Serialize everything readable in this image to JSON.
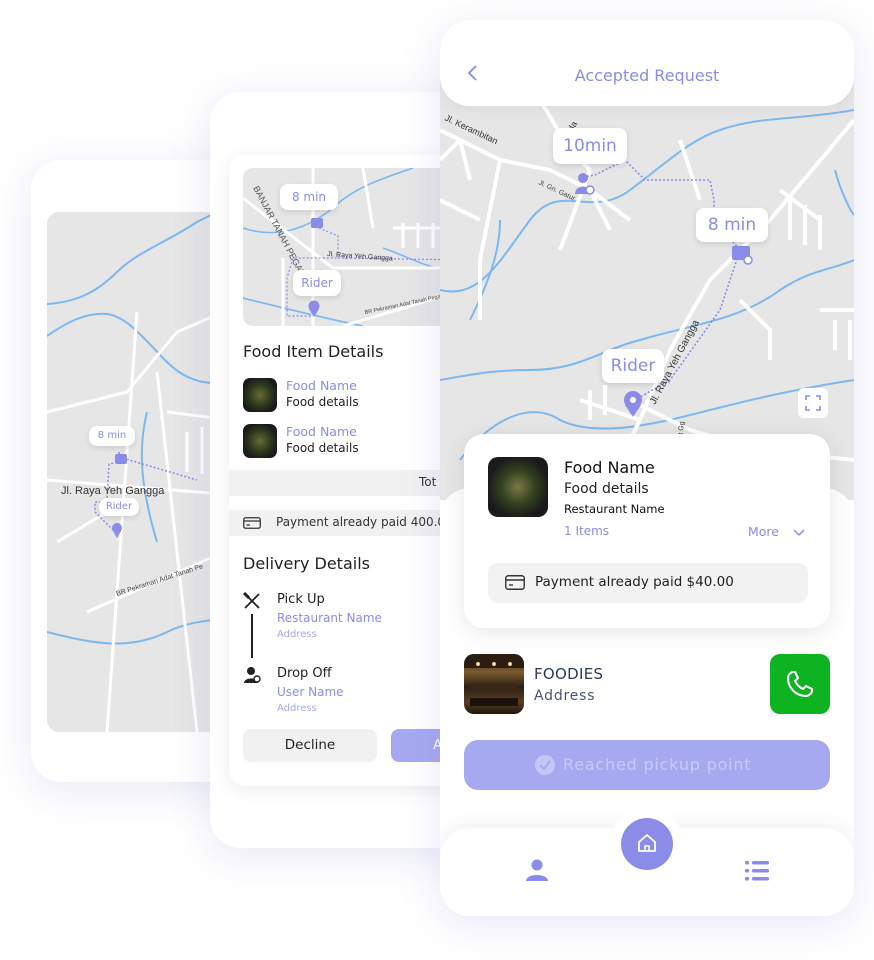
{
  "phone1": {
    "map": {
      "eta": "8 min",
      "rider": "Rider",
      "road_main": "Jl. Raya Yeh Gangga",
      "road_side": "BR Pekraman Adat Tanah Pe"
    }
  },
  "phone2": {
    "map": {
      "eta": "8 min",
      "rider": "Rider",
      "area": "BANJAR TANAH PEGAT",
      "road_main": "Jl. Raya Yeh Gangga",
      "road_side": "BR Pekraman Adat Tanah Pegat"
    },
    "food_heading": "Food Item Details",
    "foods": [
      {
        "name": "Food Name",
        "details": "Food details"
      },
      {
        "name": "Food Name",
        "details": "Food details"
      }
    ],
    "total_label": "Tot",
    "payment": "Payment already paid 400.0",
    "delivery_heading": "Delivery Details",
    "pickup": {
      "title": "Pick Up",
      "name": "Restaurant Name",
      "address": "Address"
    },
    "dropoff": {
      "title": "Drop Off",
      "name": "User Name",
      "address": "Address"
    },
    "decline": "Decline",
    "accept": "A"
  },
  "phone3": {
    "header": {
      "title": "Accepted Request"
    },
    "map": {
      "eta_top": "10min",
      "eta_right": "8 min",
      "rider": "Rider",
      "road_1": "Jl. Garuda",
      "road_2": "Jl. Kerambitan",
      "road_3": "Jl. Gn. Gatur",
      "road_main": "Jl. Raya Yeh Gangga",
      "road_4": "Jl. Pegat Gg"
    },
    "order": {
      "food_name": "Food Name",
      "food_details": "Food details",
      "restaurant": "Restaurant Name",
      "items": "1 Items",
      "more": "More",
      "payment": "Payment already paid $40.00"
    },
    "restaurant": {
      "name": "FOODIES",
      "address": "Address"
    },
    "action": "Reached pickup point"
  },
  "colors": {
    "accent": "#8a8ce8",
    "call": "#0db320",
    "map": "#e6e6e6",
    "river": "#7cb8f0"
  }
}
